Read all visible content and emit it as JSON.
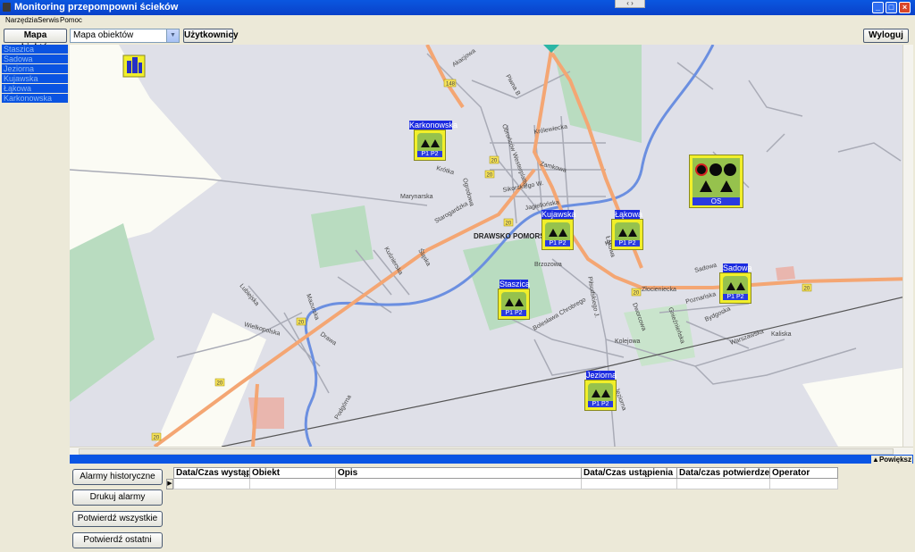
{
  "window": {
    "title": "Monitoring przepompowni ścieków",
    "controls": [
      "_",
      "□",
      "×"
    ],
    "grip": "‹ › "
  },
  "menu": {
    "items": [
      "Narzędzia",
      "Serwis",
      "Pomoc"
    ]
  },
  "toolbar": {
    "map_button": "Mapa obiektów",
    "select_value": "Mapa obiektów",
    "users_button": "Użytkownicy",
    "logout_button": "Wyloguj"
  },
  "sidebar": {
    "items": [
      "Staszica",
      "Sadowa",
      "Jeziorna",
      "Kujawska",
      "Łąkowa",
      "Karkonowska"
    ]
  },
  "map": {
    "city_label": "DRAWSKO POMORSKIE",
    "road_numbers": [
      "148",
      "20",
      "20",
      "20",
      "20",
      "20",
      "20",
      "20",
      "20"
    ],
    "street_labels": [
      "Akacjowa",
      "Piwna B",
      "Obrońców Westerplatte",
      "Królewiecka",
      "Ogrodowa",
      "Zamkowa",
      "Marynarska",
      "Sikorskiego W.",
      "Jagiellońska",
      "Starogardzka",
      "Kuśnierska",
      "Śląska",
      "Łąkowa",
      "Brzozowa",
      "Lubiejska",
      "Mazurska",
      "Wielkopolska",
      "Drawa",
      "Bolesława Chrobrego",
      "Piłsudskiego J.",
      "Złocieniecka",
      "Sadowa",
      "Poznańska",
      "Bydgoska",
      "Kaliska",
      "Kolejowa",
      "Warszawska",
      "Dworcowa",
      "Gnieźnieńska",
      "Jeziorna",
      "Podgórna",
      "Konopnickiej",
      "Krótka"
    ],
    "markers": [
      {
        "name": "Karkonowska",
        "pumps": "P1 P2"
      },
      {
        "name": "Kujawska",
        "pumps": "P1 P2"
      },
      {
        "name": "Łąkowa",
        "pumps": "P1 P2"
      },
      {
        "name": "Sadowa",
        "pumps": "P1 P2"
      },
      {
        "name": "Staszica",
        "pumps": "P1 P2"
      },
      {
        "name": "Jeziorna",
        "pumps": "P1 P2"
      }
    ],
    "treatment_plant": {
      "label": "OS"
    }
  },
  "enlarge_button": "▲Powiększ",
  "alarm_buttons": [
    "Alarmy historyczne",
    "Drukuj alarmy",
    "Potwierdź wszystkie",
    "Potwierdź ostatni"
  ],
  "alarm_table": {
    "columns": [
      "Data/Czas wystąpienia",
      "Obiekt",
      "Opis",
      "Data/Czas ustąpienia",
      "Data/czas potwierdzenia",
      "Operator"
    ],
    "row_indicator": "▶"
  },
  "colors": {
    "titlebar": "#0a57e0",
    "sidebar_item": "#0a53e1",
    "marker_frame": "#f1ef2a",
    "marker_fill": "#96c24d",
    "road_main": "#f4a673",
    "river": "#6b8fe0",
    "park": "#b9dcc0"
  }
}
